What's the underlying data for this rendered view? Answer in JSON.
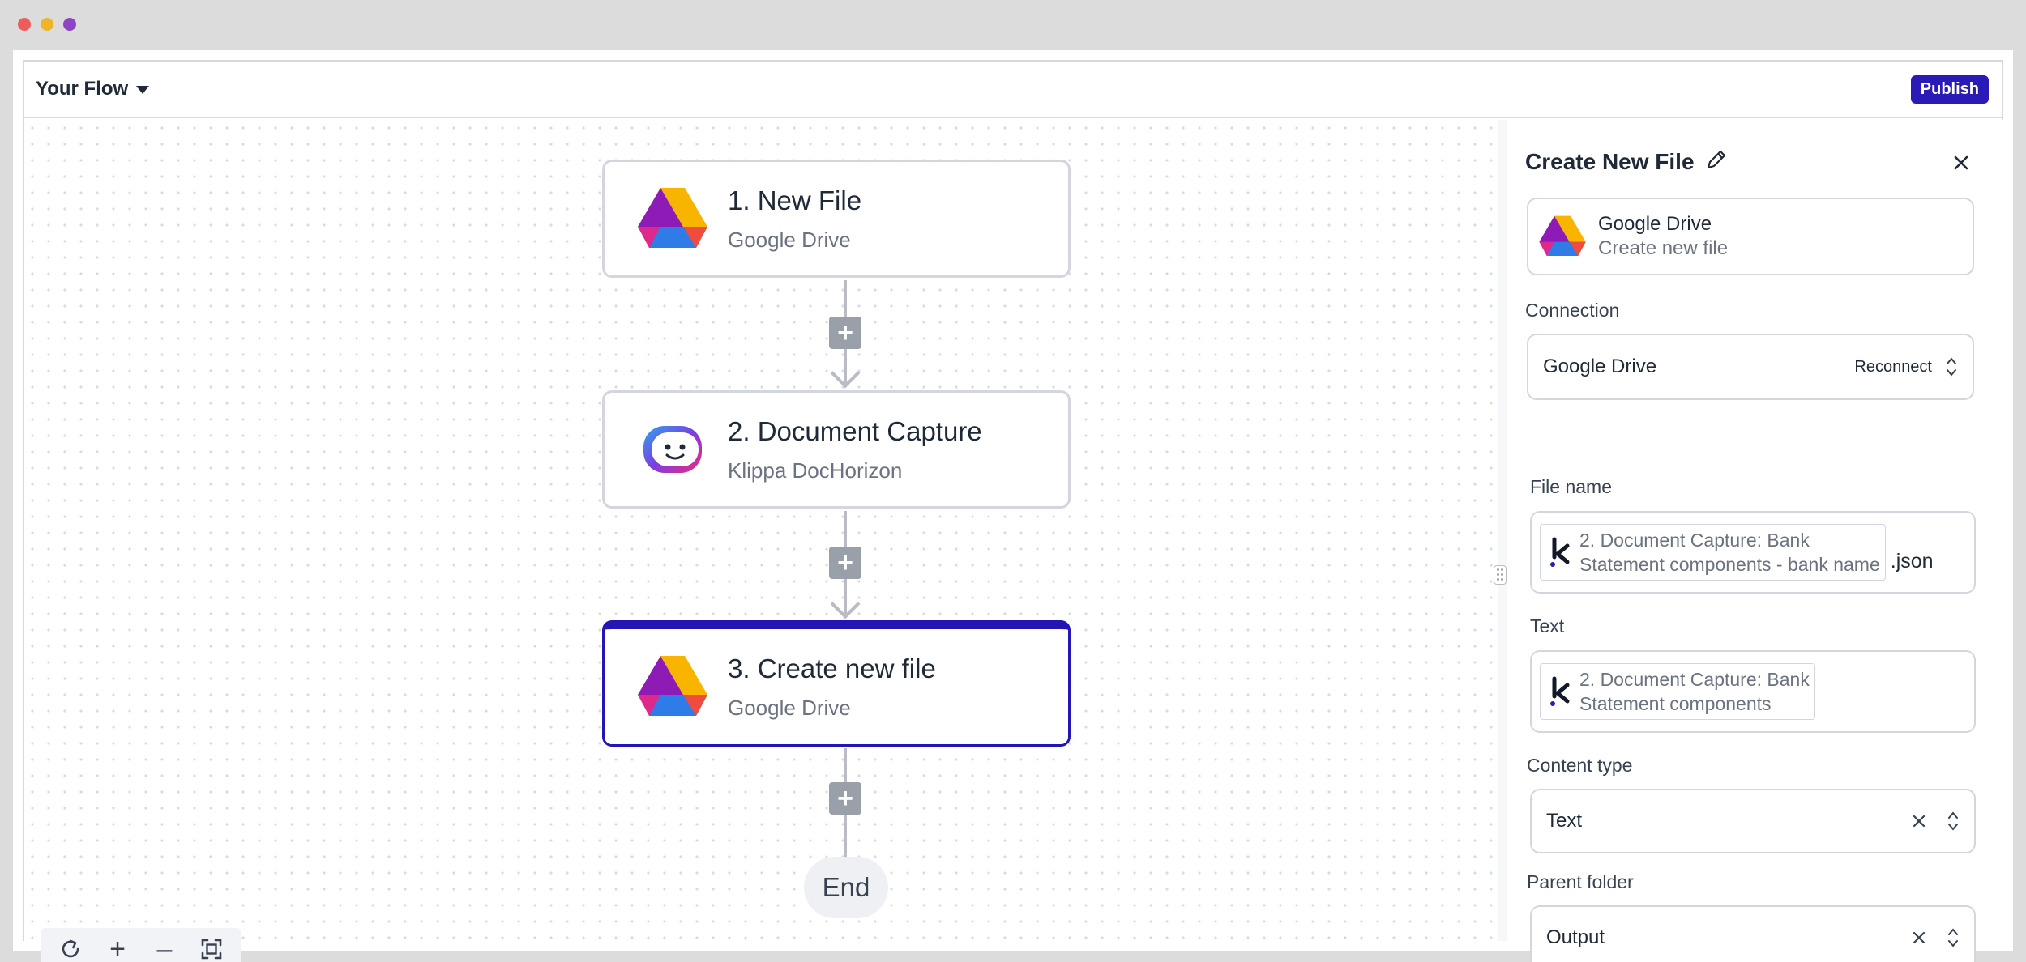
{
  "window": {
    "dot_colors": [
      "#f05a5a",
      "#f0b429",
      "#8e44c4"
    ]
  },
  "topbar": {
    "flow_title": "Your Flow",
    "publish_label": "Publish"
  },
  "flow": {
    "nodes": [
      {
        "title": "1. New File",
        "subtitle": "Google Drive",
        "icon": "google-drive-icon"
      },
      {
        "title": "2. Document Capture",
        "subtitle": "Klippa DocHorizon",
        "icon": "klippa-dochorizon-icon"
      },
      {
        "title": "3. Create new file",
        "subtitle": "Google Drive",
        "icon": "google-drive-icon",
        "selected": true
      }
    ],
    "end_label": "End",
    "add_step_symbol": "+"
  },
  "zoom_controls": {
    "reset_icon": "refresh-icon",
    "zoom_in_symbol": "+",
    "zoom_out_symbol": "–",
    "fit_icon": "fit-view-icon"
  },
  "panel": {
    "title": "Create New File",
    "app": {
      "name": "Google Drive",
      "action": "Create new file"
    },
    "connection": {
      "label": "Connection",
      "value": "Google Drive",
      "reconnect_label": "Reconnect"
    },
    "file_name": {
      "label": "File name",
      "chip_line1": "2. Document Capture: Bank",
      "chip_line2": "Statement components - bank name",
      "suffix": ".json"
    },
    "text": {
      "label": "Text",
      "chip_line1": "2. Document Capture: Bank",
      "chip_line2": "Statement components"
    },
    "content_type": {
      "label": "Content type",
      "value": "Text"
    },
    "parent_folder": {
      "label": "Parent folder",
      "value": "Output"
    }
  },
  "colors": {
    "accent": "#2a1bb8",
    "selected_border": "#2316b5"
  }
}
